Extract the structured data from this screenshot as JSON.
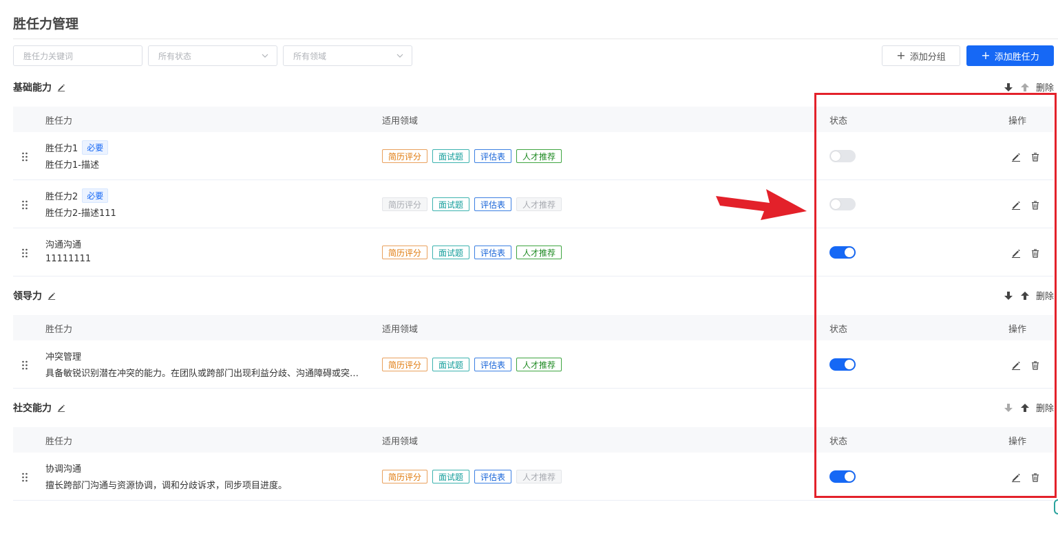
{
  "page": {
    "title": "胜任力管理"
  },
  "filters": {
    "keyword_placeholder": "胜任力关键词",
    "status_select": "所有状态",
    "domain_select": "所有领域"
  },
  "toolbar": {
    "add_group_label": "添加分组",
    "add_competency_label": "添加胜任力"
  },
  "columns": {
    "competency": "胜任力",
    "domain": "适用领域",
    "status": "状态",
    "actions": "操作"
  },
  "delete_label": "删除",
  "required_label": "必要",
  "groups": [
    {
      "name": "基础能力",
      "rows": [
        {
          "name": "胜任力1",
          "required": true,
          "desc": "胜任力1-描述",
          "tags": [
            {
              "label": "简历评分",
              "style": "orange"
            },
            {
              "label": "面试题",
              "style": "teal"
            },
            {
              "label": "评估表",
              "style": "blue"
            },
            {
              "label": "人才推荐",
              "style": "green"
            }
          ],
          "enabled": false
        },
        {
          "name": "胜任力2",
          "required": true,
          "desc": "胜任力2-描述111",
          "tags": [
            {
              "label": "简历评分",
              "style": "gray"
            },
            {
              "label": "面试题",
              "style": "teal"
            },
            {
              "label": "评估表",
              "style": "blue"
            },
            {
              "label": "人才推荐",
              "style": "gray"
            }
          ],
          "enabled": false
        },
        {
          "name": "沟通沟通",
          "required": false,
          "desc": "11111111",
          "tags": [
            {
              "label": "简历评分",
              "style": "orange"
            },
            {
              "label": "面试题",
              "style": "teal"
            },
            {
              "label": "评估表",
              "style": "blue"
            },
            {
              "label": "人才推荐",
              "style": "green"
            }
          ],
          "enabled": true
        }
      ]
    },
    {
      "name": "领导力",
      "rows": [
        {
          "name": "冲突管理",
          "required": false,
          "desc": "具备敏锐识别潜在冲突的能力。在团队或跨部门出现利益分歧、沟通障碍或突…",
          "tags": [
            {
              "label": "简历评分",
              "style": "orange"
            },
            {
              "label": "面试题",
              "style": "teal"
            },
            {
              "label": "评估表",
              "style": "blue"
            },
            {
              "label": "人才推荐",
              "style": "green"
            }
          ],
          "enabled": true
        }
      ]
    },
    {
      "name": "社交能力",
      "rows": [
        {
          "name": "协调沟通",
          "required": false,
          "desc": "擅长跨部门沟通与资源协调，调和分歧诉求，同步项目进度。",
          "tags": [
            {
              "label": "简历评分",
              "style": "orange"
            },
            {
              "label": "面试题",
              "style": "teal"
            },
            {
              "label": "评估表",
              "style": "blue"
            },
            {
              "label": "人才推荐",
              "style": "gray"
            }
          ],
          "enabled": true
        }
      ]
    }
  ],
  "colors": {
    "primary": "#1668f5",
    "highlight": "#e3212a"
  }
}
